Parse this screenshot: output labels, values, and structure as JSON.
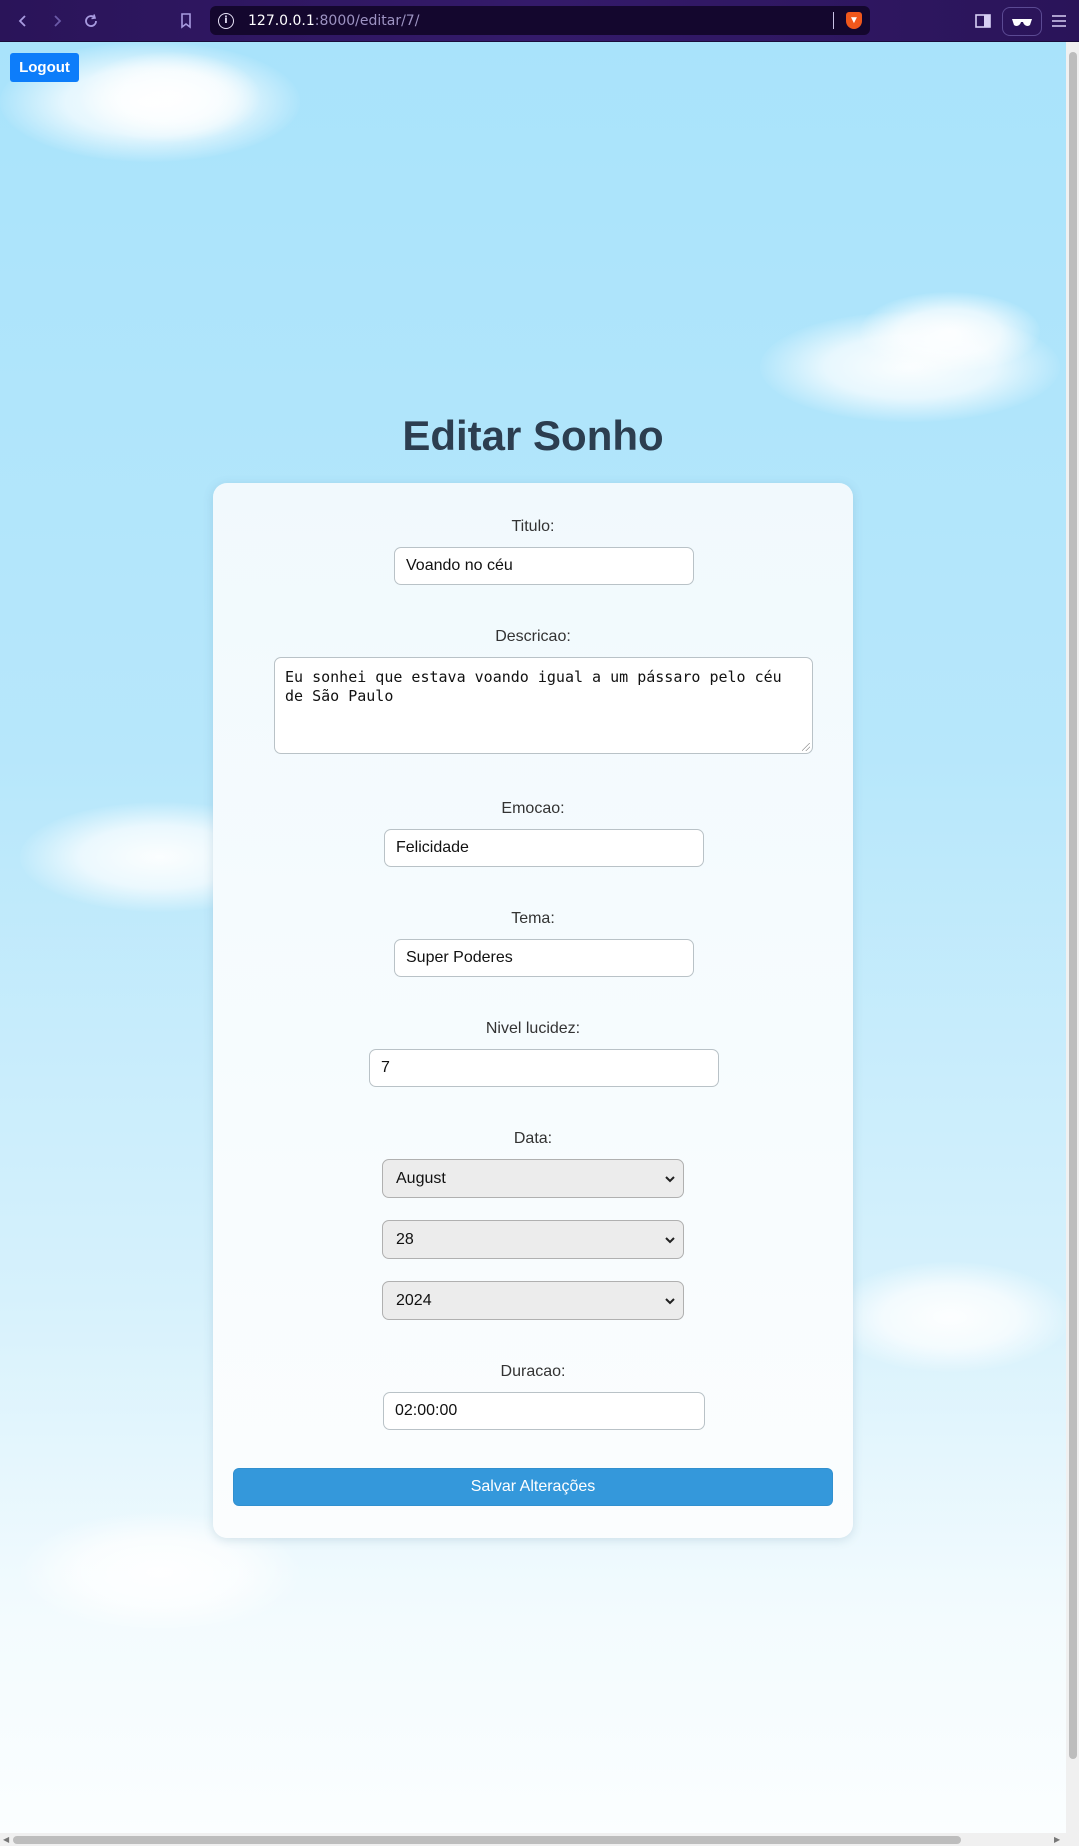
{
  "browser": {
    "url_host": "127.0.0.1",
    "url_rest": ":8000/editar/7/"
  },
  "page": {
    "logout_label": "Logout",
    "title": "Editar Sonho",
    "colors": {
      "title": "#2c3e50",
      "logout": "#0d7dfa",
      "save": "#3498db"
    }
  },
  "form": {
    "titulo": {
      "label": "Titulo:",
      "value": "Voando no céu"
    },
    "descricao": {
      "label": "Descricao:",
      "value": "Eu sonhei que estava voando igual a um pássaro pelo céu de São Paulo"
    },
    "emocao": {
      "label": "Emocao:",
      "value": "Felicidade"
    },
    "tema": {
      "label": "Tema:",
      "value": "Super Poderes"
    },
    "nivel_lucidez": {
      "label": "Nivel lucidez:",
      "value": "7"
    },
    "data": {
      "label": "Data:",
      "month": "August",
      "day": "28",
      "year": "2024"
    },
    "duracao": {
      "label": "Duracao:",
      "value": "02:00:00"
    },
    "save_label": "Salvar Alterações"
  }
}
